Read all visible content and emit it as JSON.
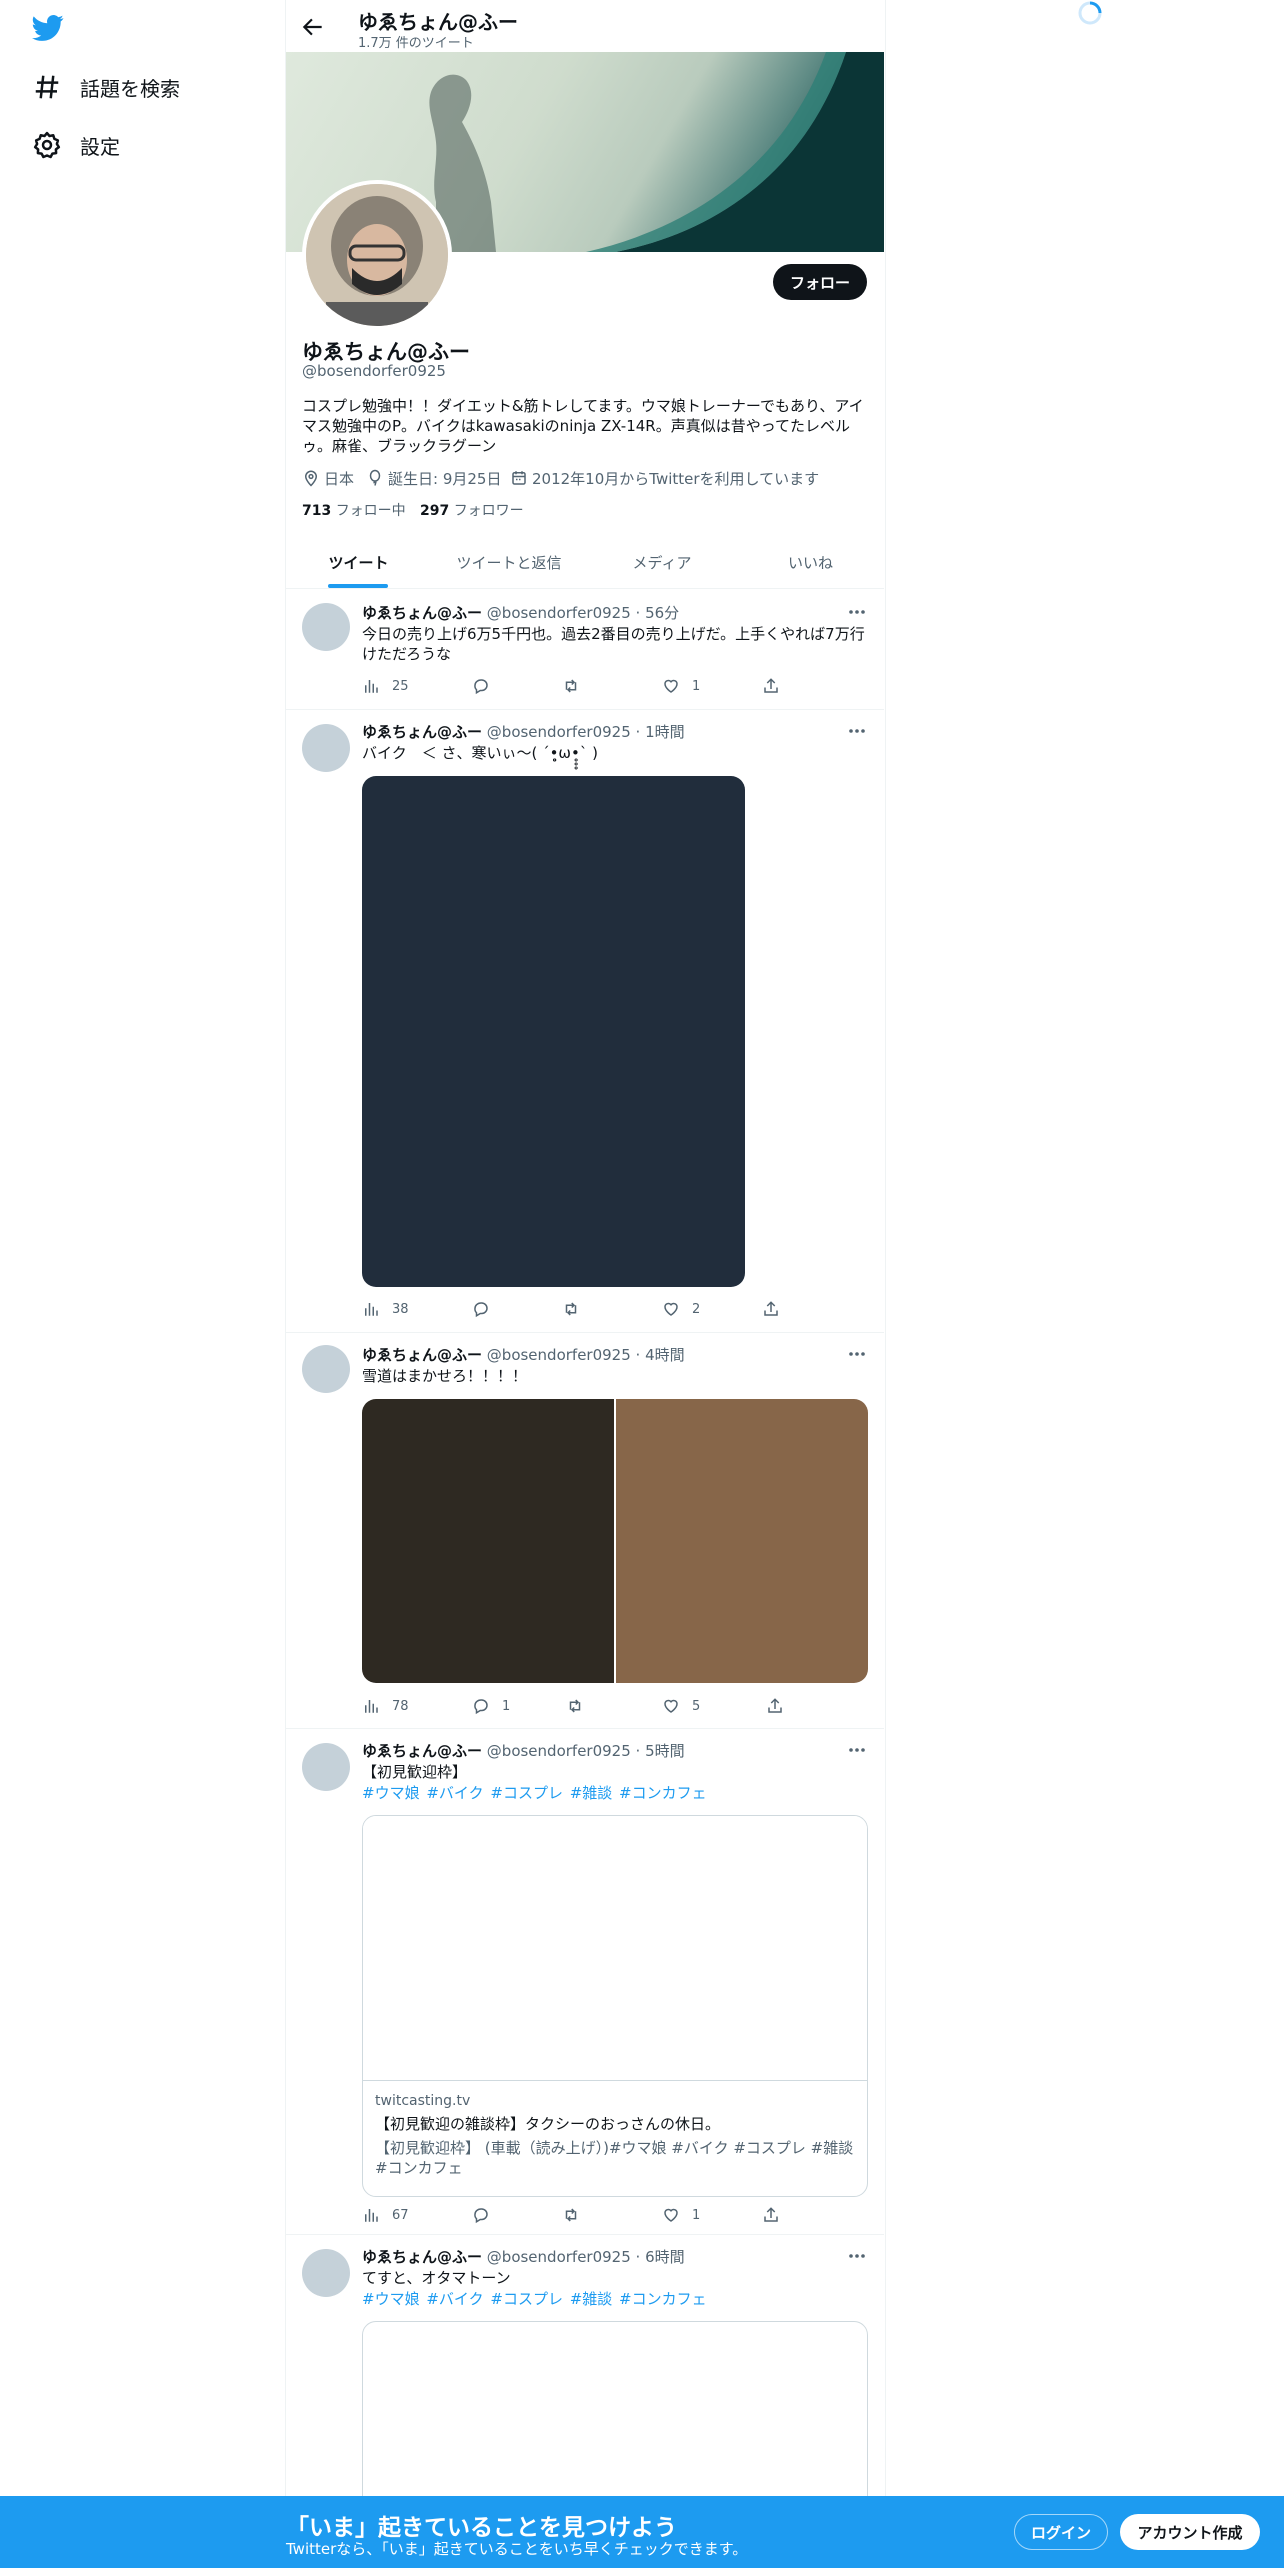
{
  "nav": {
    "logo_icon": "twitter-bird-icon",
    "items": [
      {
        "label": "話題を検索",
        "icon": "hashtag-icon"
      },
      {
        "label": "設定",
        "icon": "gear-icon"
      }
    ]
  },
  "header": {
    "name": "ゆゑちょん@ふー",
    "tweet_count": "1.7万 件のツイート"
  },
  "profile": {
    "name": "ゆゑちょん@ふー",
    "handle": "@bosendorfer0925",
    "follow_label": "フォロー",
    "bio": "コスプレ勉強中！！ダイエット&筋トレしてます。ウマ娘トレーナーでもあり、アイマス勉強中のP。バイクはkawasakiのninja ZX-14R。声真似は昔やってたレベルゥ。麻雀、ブラックラグーン",
    "location": "日本",
    "birthday": "誕生日: 9月25日",
    "joined": "2012年10月からTwitterを利用しています",
    "following_count": "713",
    "following_label": "フォロー中",
    "followers_count": "297",
    "followers_label": "フォロワー"
  },
  "tabs": [
    {
      "label": "ツイート",
      "active": true
    },
    {
      "label": "ツイートと返信",
      "active": false
    },
    {
      "label": "メディア",
      "active": false
    },
    {
      "label": "いいね",
      "active": false
    }
  ],
  "tweets": [
    {
      "name": "ゆゑちょん@ふー",
      "meta": "@bosendorfer0925 · 56分",
      "text": "今日の売り上げ6万5千円也。過去2番目の売り上げだ。上手くやれば7万行けただろうな",
      "views": "25",
      "replies": "",
      "retweets": "",
      "likes": "1"
    },
    {
      "name": "ゆゑちょん@ふー",
      "meta": "@bosendorfer0925 · 1時間",
      "text": "バイク　＜ さ、寒いぃ〜( ´•̥̥̥ω•̥̥̥` )",
      "views": "38",
      "replies": "",
      "retweets": "",
      "likes": "2"
    },
    {
      "name": "ゆゑちょん@ふー",
      "meta": "@bosendorfer0925 · 4時間",
      "text": "雪道はまかせろ！！！！",
      "views": "78",
      "replies": "1",
      "retweets": "",
      "likes": "5"
    },
    {
      "name": "ゆゑちょん@ふー",
      "meta": "@bosendorfer0925 · 5時間",
      "text": "【初見歓迎枠】",
      "tags": "#ウマ娘 #バイク #コスプレ #雑談 #コンカフェ",
      "card": {
        "domain": "twitcasting.tv",
        "title": "【初見歓迎の雑談枠】タクシーのおっさんの休日。",
        "desc": "【初見歓迎枠】 (車載（読み上げ）)#ウマ娘 #バイク #コスプレ #雑談 #コンカフェ"
      },
      "views": "67",
      "replies": "",
      "retweets": "",
      "likes": "1"
    },
    {
      "name": "ゆゑちょん@ふー",
      "meta": "@bosendorfer0925 · 6時間",
      "text": "てすと、オタマトーン",
      "tags": "#ウマ娘 #バイク #コスプレ #雑談 #コンカフェ"
    }
  ],
  "bottom_bar": {
    "title": "「いま」起きていることを見つけよう",
    "subtitle": "Twitterなら、「いま」起きていることをいち早くチェックできます。",
    "login_label": "ログイン",
    "signup_label": "アカウント作成"
  },
  "colors": {
    "accent": "#1d9bf0",
    "text": "#0f1419",
    "secondary": "#536471",
    "media_dark": "#212d3c"
  }
}
